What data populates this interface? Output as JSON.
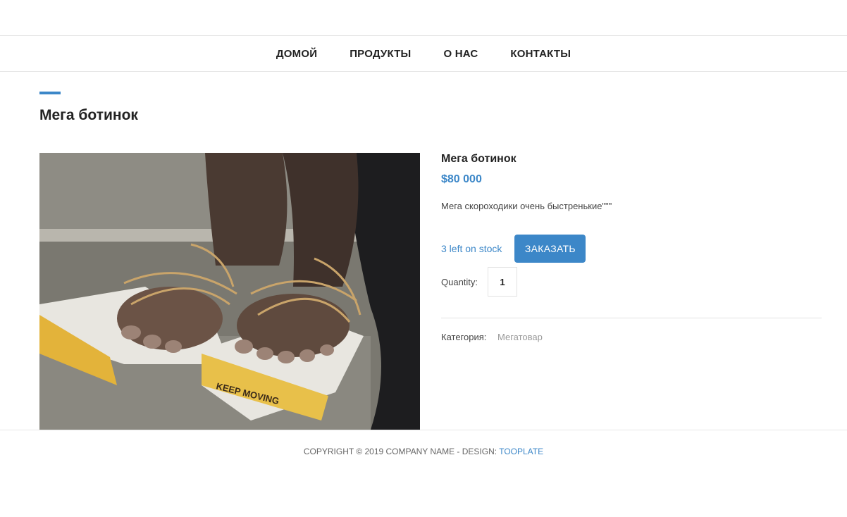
{
  "nav": {
    "items": [
      {
        "label": "ДОМОЙ"
      },
      {
        "label": "ПРОДУКТЫ"
      },
      {
        "label": "О НАС"
      },
      {
        "label": "КОНТАКТЫ"
      }
    ]
  },
  "page": {
    "title": "Мега ботинок"
  },
  "product": {
    "name": "Мега ботинок",
    "price": "$80 000",
    "description": "Мега скороходики очень быстренькие\"\"\"",
    "stock": "3 left on stock",
    "order_label": "ЗАКАЗАТЬ",
    "quantity_label": "Quantity:",
    "quantity_value": "1",
    "category_label": "Категория:",
    "category_value": "Мегатовар",
    "image_text": "KEEP MOVING"
  },
  "footer": {
    "copyright": "COPYRIGHT © 2019 COMPANY NAME - DESIGN: ",
    "link_label": "TOOPLATE"
  },
  "colors": {
    "accent": "#3c87c8"
  }
}
